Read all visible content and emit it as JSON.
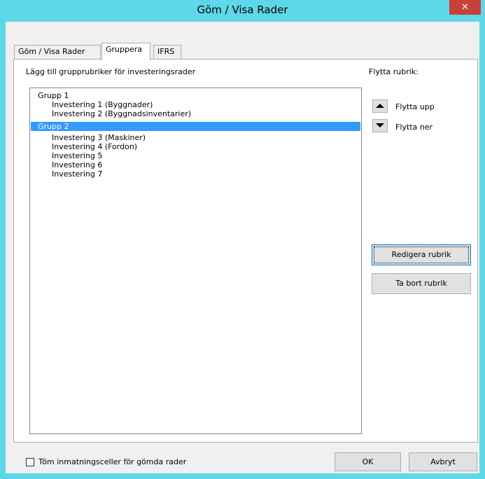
{
  "window": {
    "title": "Göm / Visa Rader",
    "close_label": "✕"
  },
  "tabs": [
    {
      "label": "Göm / Visa Rader"
    },
    {
      "label": "Gruppera"
    },
    {
      "label": "IFRS"
    }
  ],
  "panel": {
    "list_caption": "Lägg till grupprubriker för investeringsrader",
    "move_caption": "Flytta rubrik:",
    "items": [
      {
        "label": "Grupp 1"
      },
      {
        "label": "Investering 1 (Byggnader)"
      },
      {
        "label": "Investering 2 (Byggnadsinventarier)"
      },
      {
        "label": "Grupp 2"
      },
      {
        "label": "Investering 3 (Maskiner)"
      },
      {
        "label": "Investering 4 (Fordon)"
      },
      {
        "label": "Investering 5"
      },
      {
        "label": "Investering 6"
      },
      {
        "label": "Investering 7"
      }
    ],
    "move_up_label": "Flytta upp",
    "move_down_label": "Flytta ner",
    "edit_button": "Redigera rubrik",
    "delete_button": "Ta bort rubrik"
  },
  "footer": {
    "checkbox_label": "Töm inmatningsceller för gömda rader",
    "ok_button": "OK",
    "cancel_button": "Avbryt"
  },
  "colors": {
    "titlebar": "#5ed8e8",
    "close": "#c7413a",
    "selection": "#3399ff"
  }
}
